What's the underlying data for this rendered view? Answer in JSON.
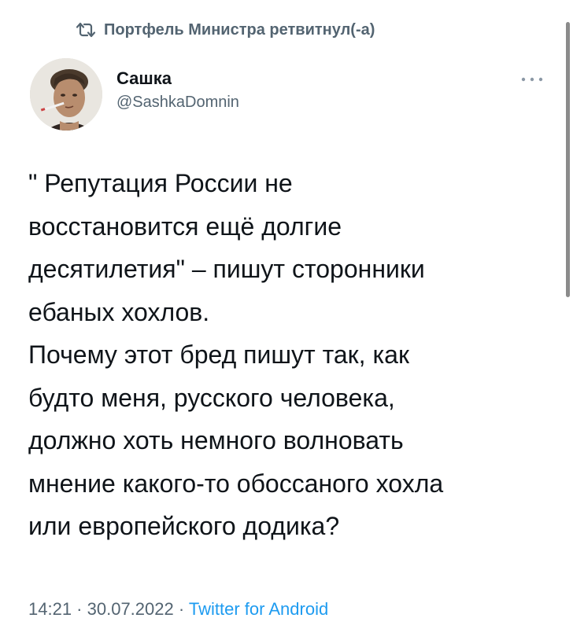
{
  "retweet": {
    "icon": "retweet-icon",
    "text": "Портфель Министра ретвитнул(-а)"
  },
  "author": {
    "display_name": "Сашка",
    "handle": "@SashkaDomnin",
    "avatar": "avatar-photo"
  },
  "more": {
    "icon": "more-horizontal-icon"
  },
  "tweet": {
    "text": "\" Репутация России не\nвосстановится ещё долгие\nдесятилетия\" – пишут сторонники\nебаных хохлов.\nПочему этот бред пишут так, как\nбудто меня, русского человека,\nдолжно хоть немного волновать\nмнение какого-то обоссаного хохла\nили европейского додика?"
  },
  "meta": {
    "time": "14:21",
    "separator": " · ",
    "date": "30.07.2022",
    "source": "Twitter for Android"
  },
  "colors": {
    "secondary_text": "#536471",
    "link": "#1d9bf0",
    "primary_text": "#0f1419"
  }
}
